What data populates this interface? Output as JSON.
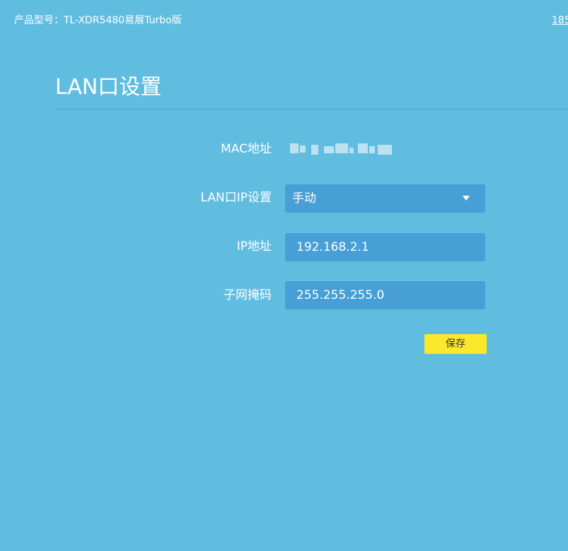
{
  "header": {
    "model_text": "产品型号：TL-XDR5480易展Turbo版",
    "right_link": "185"
  },
  "page": {
    "title": "LAN口设置"
  },
  "form": {
    "mac": {
      "label": "MAC地址"
    },
    "lan_ip_mode": {
      "label": "LAN口IP设置",
      "selected": "手动"
    },
    "ip_address": {
      "label": "IP地址",
      "value": "192.168.2.1"
    },
    "subnet_mask": {
      "label": "子网掩码",
      "value": "255.255.255.0"
    },
    "save_label": "保存"
  },
  "colors": {
    "background": "#60bde0",
    "field_background": "#479fd6",
    "save_button": "#fae82a"
  }
}
